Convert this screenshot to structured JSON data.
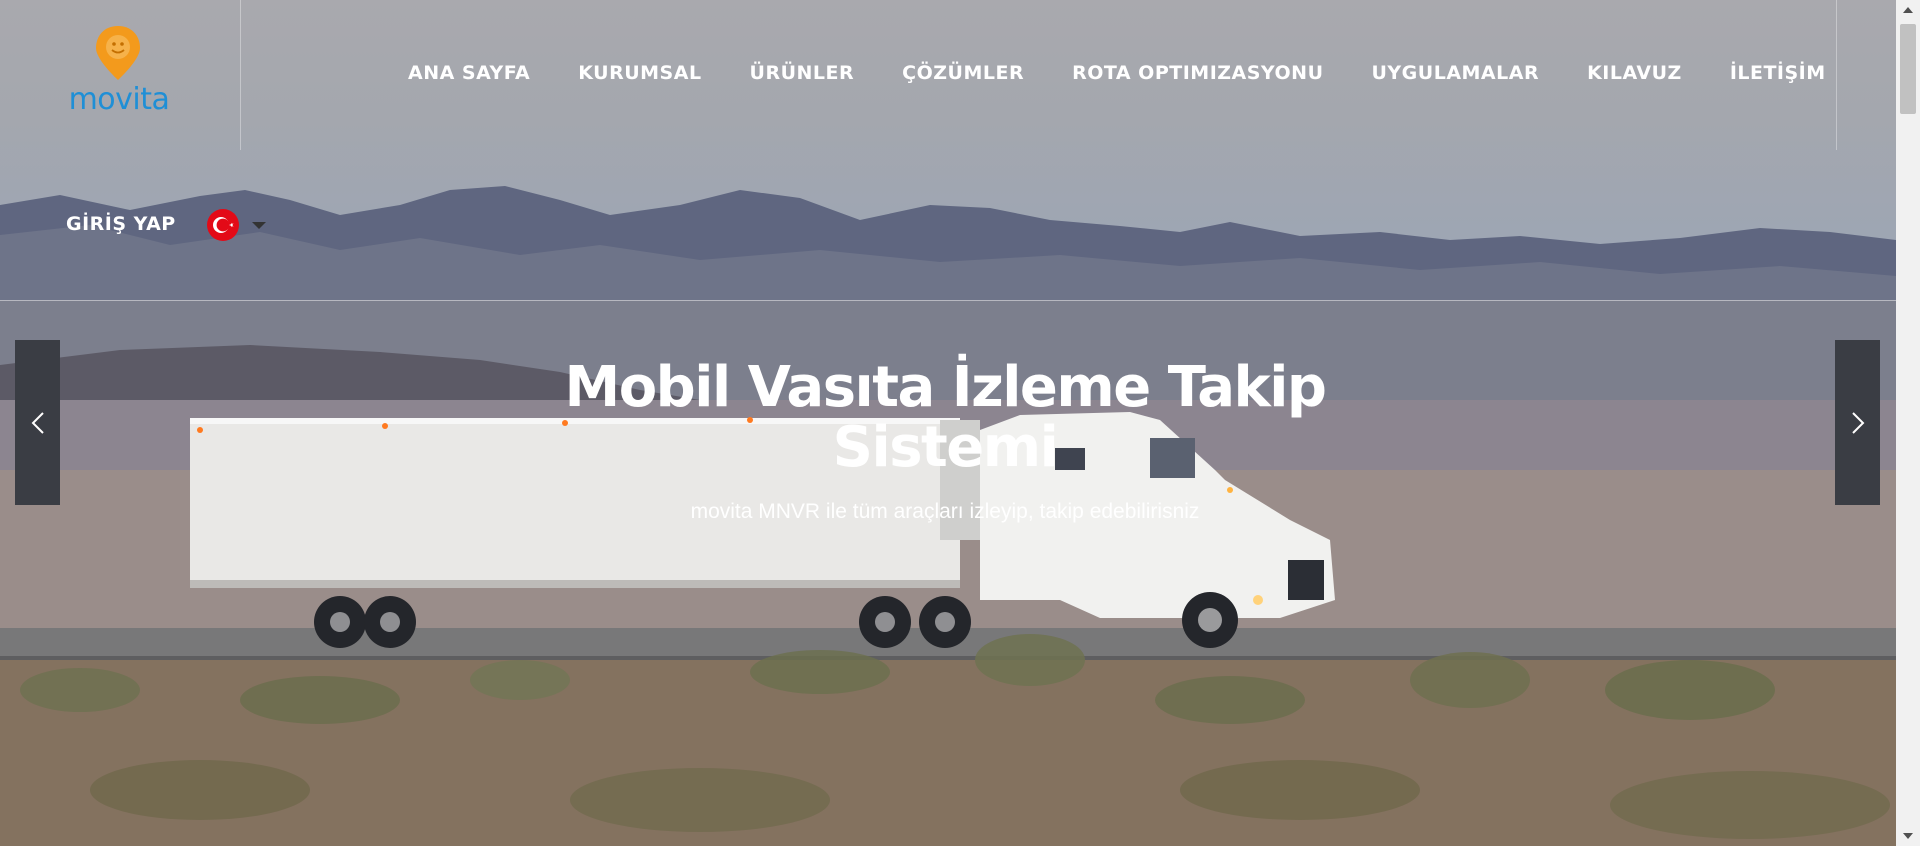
{
  "brand": {
    "name": "movita"
  },
  "nav": {
    "items": [
      {
        "label": "ANA SAYFA"
      },
      {
        "label": "KURUMSAL"
      },
      {
        "label": "ÜRÜNLER"
      },
      {
        "label": "ÇÖZÜMLER"
      },
      {
        "label": "ROTA OPTIMIZASYONU"
      },
      {
        "label": "UYGULAMALAR"
      },
      {
        "label": "KILAVUZ"
      },
      {
        "label": "İLETİŞİM"
      }
    ],
    "login_label": "GİRİŞ YAP",
    "language_icon": "turkey-flag-icon"
  },
  "hero": {
    "title": "Mobil Vasıta İzleme Takip Sistemi",
    "subtitle": "movita MNVR ile tüm araçları izleyip, takip edebilirisniz",
    "prev_icon": "chevron-left-icon",
    "next_icon": "chevron-right-icon"
  },
  "colors": {
    "brand_orange": "#f39a1c",
    "brand_blue": "#1f8fd6",
    "arrow_bg": "#3a3d44",
    "flag_red": "#e30a17"
  }
}
